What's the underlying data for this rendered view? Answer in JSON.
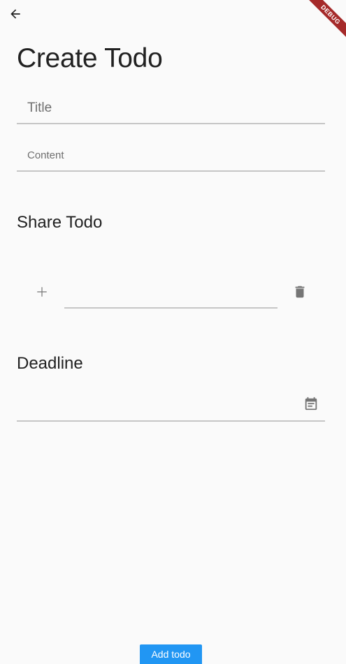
{
  "header": {
    "back_icon": "arrow-back-icon",
    "debug_banner": "DEBUG",
    "title": "Create Todo"
  },
  "form": {
    "title_placeholder": "Title",
    "title_value": "",
    "content_placeholder": "Content",
    "content_value": ""
  },
  "share": {
    "heading": "Share Todo",
    "add_icon": "plus-icon",
    "delete_icon": "trash-icon",
    "user_value": ""
  },
  "deadline": {
    "heading": "Deadline",
    "value": "",
    "calendar_icon": "calendar-icon"
  },
  "footer": {
    "add_button_label": "Add todo"
  },
  "colors": {
    "background": "#fafafa",
    "primary": "#2196f3",
    "debug_banner": "#a52a2a",
    "icon_grey": "#757575",
    "underline": "#c6c6c6"
  }
}
